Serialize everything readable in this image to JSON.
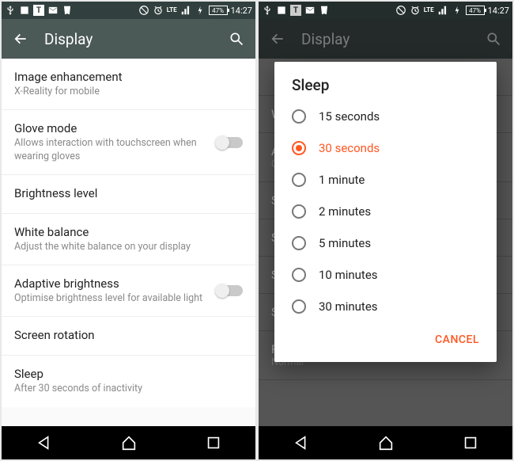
{
  "statusbar": {
    "battery": "47%",
    "time": "14:27",
    "lte": "LTE"
  },
  "left_screen": {
    "appbar_title": "Display",
    "rows": {
      "image_enhancement": {
        "title": "Image enhancement",
        "sub": "X-Reality for mobile"
      },
      "glove_mode": {
        "title": "Glove mode",
        "sub": "Allows interaction with touchscreen when wearing gloves"
      },
      "brightness_level": {
        "title": "Brightness level"
      },
      "white_balance": {
        "title": "White balance",
        "sub": "Adjust the white balance on your display"
      },
      "adaptive_brightness": {
        "title": "Adaptive brightness",
        "sub": "Optimise brightness level for available light"
      },
      "screen_rotation": {
        "title": "Screen rotation"
      },
      "sleep": {
        "title": "Sleep",
        "sub": "After 30 seconds of inactivity"
      }
    }
  },
  "right_screen": {
    "appbar_title": "Display",
    "dialog_title": "Sleep",
    "options": [
      "15 seconds",
      "30 seconds",
      "1 minute",
      "2 minutes",
      "5 minutes",
      "10 minutes",
      "30 minutes"
    ],
    "selected_index": 1,
    "cancel": "CANCEL",
    "bg_font_size": {
      "title": "Font size",
      "sub": "Normal"
    }
  }
}
